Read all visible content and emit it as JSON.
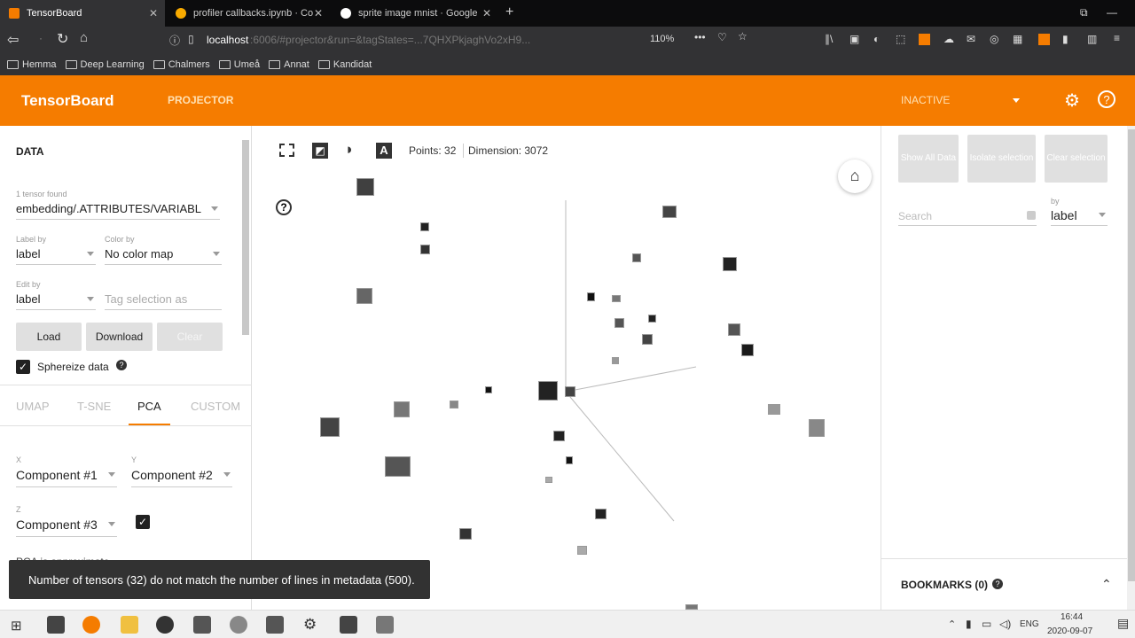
{
  "browser": {
    "tabs": [
      {
        "title": "TensorBoard",
        "active": true
      },
      {
        "title": "profiler callbacks.ipynb · Co",
        "active": false
      },
      {
        "title": "sprite image mnist · Google",
        "active": false
      }
    ],
    "new_tab": "+",
    "url_host": "localhost",
    "url_rest": ":6006/#projector&run=&tagStates=...7QHXPkjaghVo2xH9...",
    "zoom": "110%",
    "bookmarks": [
      "Hemma",
      "Deep Learning",
      "Chalmers",
      "Umeå",
      "Annat",
      "Kandidat"
    ]
  },
  "header": {
    "title": "TensorBoard",
    "nav": "PROJECTOR",
    "status": "INACTIVE"
  },
  "data_panel": {
    "section_title": "DATA",
    "tensor_found_label": "1 tensor found",
    "tensor_value": "embedding/.ATTRIBUTES/VARIABL",
    "label_by_label": "Label by",
    "label_by_value": "label",
    "color_by_label": "Color by",
    "color_by_value": "No color map",
    "edit_by_label": "Edit by",
    "edit_by_value": "label",
    "tag_placeholder": "Tag selection as",
    "load_button": "Load",
    "download_button": "Download",
    "clear_button": "Clear",
    "sphereize_label": "Sphereize data",
    "sphereize_checked": true
  },
  "projection_tabs": [
    "UMAP",
    "T-SNE",
    "PCA",
    "CUSTOM"
  ],
  "active_projection_tab": "PCA",
  "pca": {
    "x_label": "X",
    "x_value": "Component #1",
    "y_label": "Y",
    "y_value": "Component #2",
    "z_label": "Z",
    "z_value": "Component #3",
    "z_enabled": true,
    "partial_text": "PCA is approximate"
  },
  "toolbar": {
    "points": "Points: 32",
    "dimension": "Dimension: 3072"
  },
  "right_panel": {
    "show_all_button": "Show All Data",
    "isolate_button": "Isolate selection",
    "clear_selection_button": "Clear selection",
    "search_placeholder": "Search",
    "by_label": "by",
    "by_value": "label",
    "bookmarks": "BOOKMARKS (0)"
  },
  "toast": "Number of tensors (32) do not match the number of lines in metadata (500).",
  "taskbar": {
    "lang": "ENG",
    "time": "16:44",
    "date": "2020-09-07"
  },
  "colors": {
    "accent": "#f57c00",
    "browser_dark": "#323234",
    "toast_bg": "#323232"
  }
}
